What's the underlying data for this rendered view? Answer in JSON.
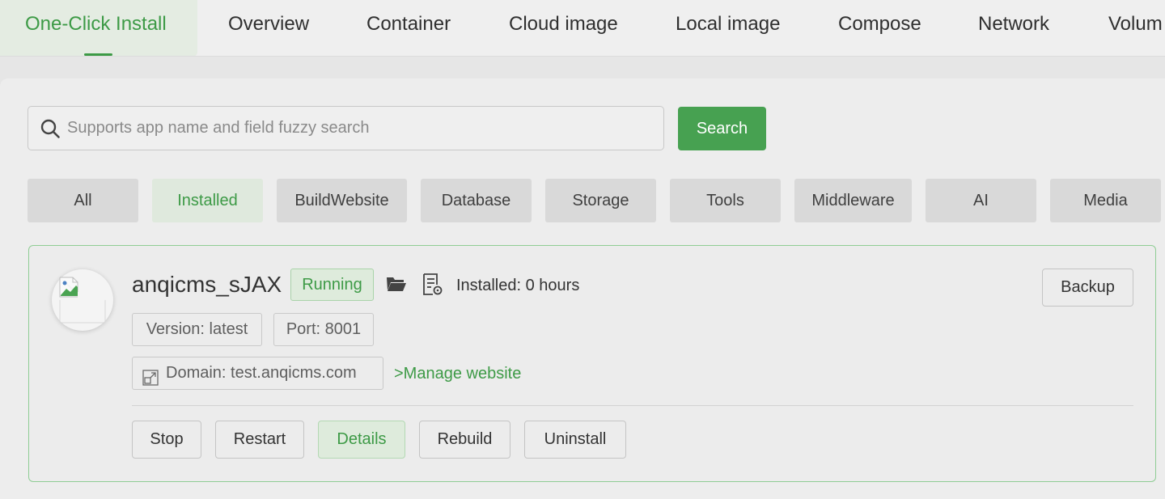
{
  "tabs": [
    {
      "label": "One-Click Install",
      "active": true
    },
    {
      "label": "Overview"
    },
    {
      "label": "Container"
    },
    {
      "label": "Cloud image"
    },
    {
      "label": "Local image"
    },
    {
      "label": "Compose"
    },
    {
      "label": "Network"
    },
    {
      "label": "Volum"
    }
  ],
  "search": {
    "placeholder": "Supports app name and field fuzzy search",
    "value": "",
    "button_label": "Search"
  },
  "categories": [
    {
      "label": "All"
    },
    {
      "label": "Installed",
      "active": true
    },
    {
      "label": "BuildWebsite"
    },
    {
      "label": "Database"
    },
    {
      "label": "Storage"
    },
    {
      "label": "Tools"
    },
    {
      "label": "Middleware"
    },
    {
      "label": "AI"
    },
    {
      "label": "Media"
    }
  ],
  "app": {
    "name": "anqicms_sJAX",
    "status": "Running",
    "installed": "Installed: 0 hours",
    "version": "Version: latest",
    "port": "Port: 8001",
    "domain": "Domain: test.anqicms.com",
    "manage_link": ">Manage website",
    "actions": {
      "backup": "Backup",
      "stop": "Stop",
      "restart": "Restart",
      "details": "Details",
      "rebuild": "Rebuild",
      "uninstall": "Uninstall"
    }
  },
  "colors": {
    "accent": "#3d9a46",
    "search_button": "#47a151"
  },
  "icons": {
    "search": "search-icon",
    "folder": "folder-icon",
    "log": "log-file-icon",
    "external": "external-link-icon",
    "app_image": "broken-image-icon"
  }
}
